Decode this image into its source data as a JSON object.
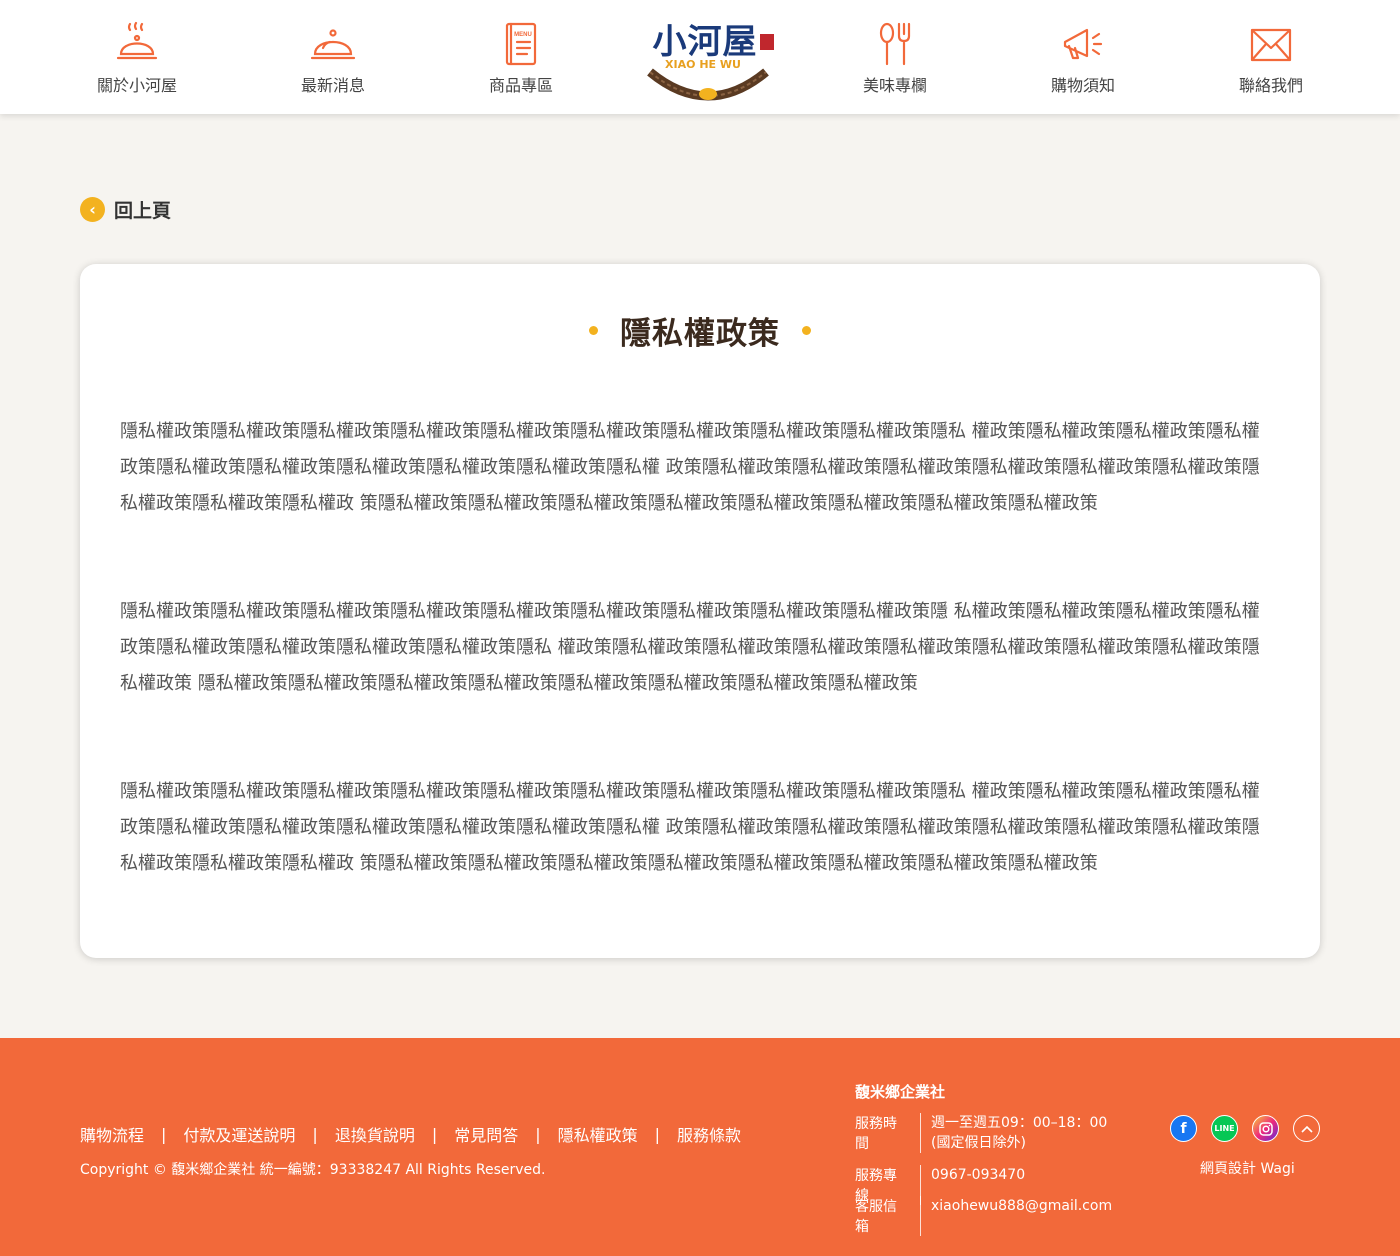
{
  "nav": {
    "items": [
      {
        "label": "關於小河屋",
        "icon": "cloche-steam-icon"
      },
      {
        "label": "最新消息",
        "icon": "cloche-icon"
      },
      {
        "label": "商品專區",
        "icon": "menu-book-icon"
      },
      {
        "label": "美味專欄",
        "icon": "spoon-fork-icon"
      },
      {
        "label": "購物須知",
        "icon": "megaphone-icon"
      },
      {
        "label": "聯絡我們",
        "icon": "envelope-icon"
      }
    ],
    "logo_title": "小河屋",
    "logo_sub": "XIAO HE WU"
  },
  "back": {
    "label": "回上頁"
  },
  "page": {
    "title": "隱私權政策",
    "paragraphs": [
      "隱私權政策隱私權政策隱私權政策隱私權政策隱私權政策隱私權政策隱私權政策隱私權政策隱私權政策隱私 權政策隱私權政策隱私權政策隱私權政策隱私權政策隱私權政策隱私權政策隱私權政策隱私權政策隱私權 政策隱私權政策隱私權政策隱私權政策隱私權政策隱私權政策隱私權政策隱私權政策隱私權政策隱私權政 策隱私權政策隱私權政策隱私權政策隱私權政策隱私權政策隱私權政策隱私權政策隱私權政策",
      "隱私權政策隱私權政策隱私權政策隱私權政策隱私權政策隱私權政策隱私權政策隱私權政策隱私權政策隱 私權政策隱私權政策隱私權政策隱私權政策隱私權政策隱私權政策隱私權政策隱私權政策隱私 權政策隱私權政策隱私權政策隱私權政策隱私權政策隱私權政策隱私權政策隱私權政策隱私權政策 隱私權政策隱私權政策隱私權政策隱私權政策隱私權政策隱私權政策隱私權政策隱私權政策",
      "隱私權政策隱私權政策隱私權政策隱私權政策隱私權政策隱私權政策隱私權政策隱私權政策隱私權政策隱私 權政策隱私權政策隱私權政策隱私權政策隱私權政策隱私權政策隱私權政策隱私權政策隱私權政策隱私權 政策隱私權政策隱私權政策隱私權政策隱私權政策隱私權政策隱私權政策隱私權政策隱私權政策隱私權政 策隱私權政策隱私權政策隱私權政策隱私權政策隱私權政策隱私權政策隱私權政策隱私權政策"
    ]
  },
  "footer": {
    "links": [
      "購物流程",
      "付款及運送說明",
      "退換貨說明",
      "常見問答",
      "隱私權政策",
      "服務條款"
    ],
    "separator": "|",
    "copyright": "Copyright © 馥米鄉企業社 統一編號：93338247 All Rights Reserved.",
    "company": "馥米鄉企業社",
    "hours_label": "服務時間",
    "hours_value": "週一至週五09：00–18：00",
    "hours_note": "(國定假日除外)",
    "phone_label": "服務專線",
    "phone_value": "0967-093470",
    "email_label": "客服信箱",
    "email_value": "xiaohewu888@gmail.com",
    "social": [
      "facebook-icon",
      "line-icon",
      "instagram-icon",
      "back-to-top-icon"
    ],
    "designer": "網頁設計 Wagi"
  },
  "colors": {
    "accent": "#f3b21f",
    "icon_orange": "#f2693a",
    "footer_bg": "#f2693a",
    "logo_blue": "#1a3a7a"
  }
}
